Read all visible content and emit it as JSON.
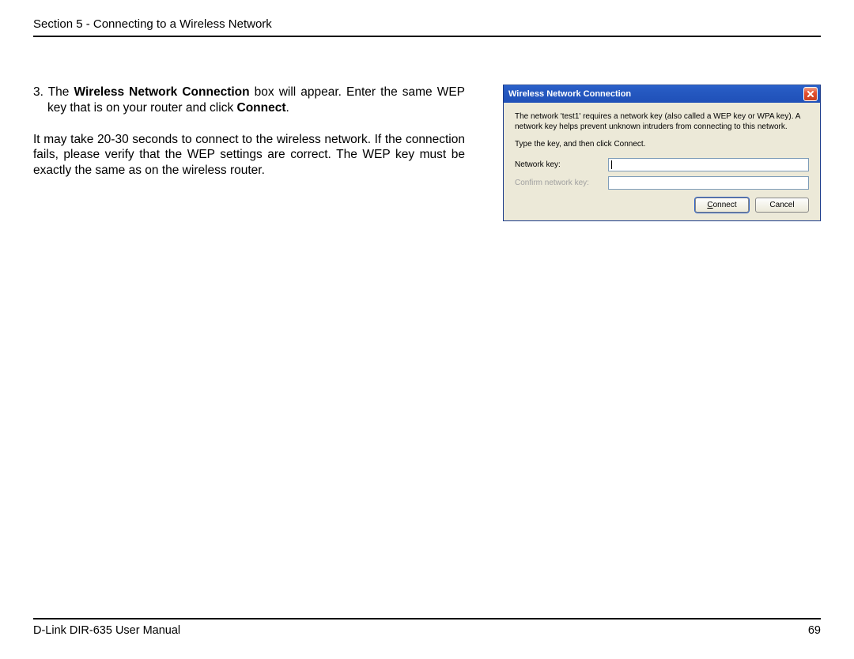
{
  "header": {
    "section_title": "Section 5 - Connecting to a Wireless Network"
  },
  "instructions": {
    "step_number": "3.",
    "step_text_prefix": "The ",
    "step_bold_1": "Wireless Network Connection",
    "step_text_middle": " box will appear. Enter the same WEP key that is on your router and click ",
    "step_bold_2": "Connect",
    "step_text_suffix": ".",
    "paragraph2": "It may take 20-30 seconds to connect to the wireless network. If the connection fails, please verify that the WEP settings are correct. The WEP key must be exactly the same as on the wireless router."
  },
  "dialog": {
    "title": "Wireless Network Connection",
    "description": "The network 'test1' requires a network key (also called a WEP key or WPA key). A network key helps prevent unknown intruders from connecting to this network.",
    "type_instruction": "Type the key, and then click Connect.",
    "network_key_label": "Network key:",
    "confirm_key_label": "Confirm network key:",
    "network_key_value": "",
    "confirm_key_value": "",
    "connect_button": "Connect",
    "cancel_button": "Cancel"
  },
  "footer": {
    "manual_name": "D-Link DIR-635 User Manual",
    "page_number": "69"
  }
}
